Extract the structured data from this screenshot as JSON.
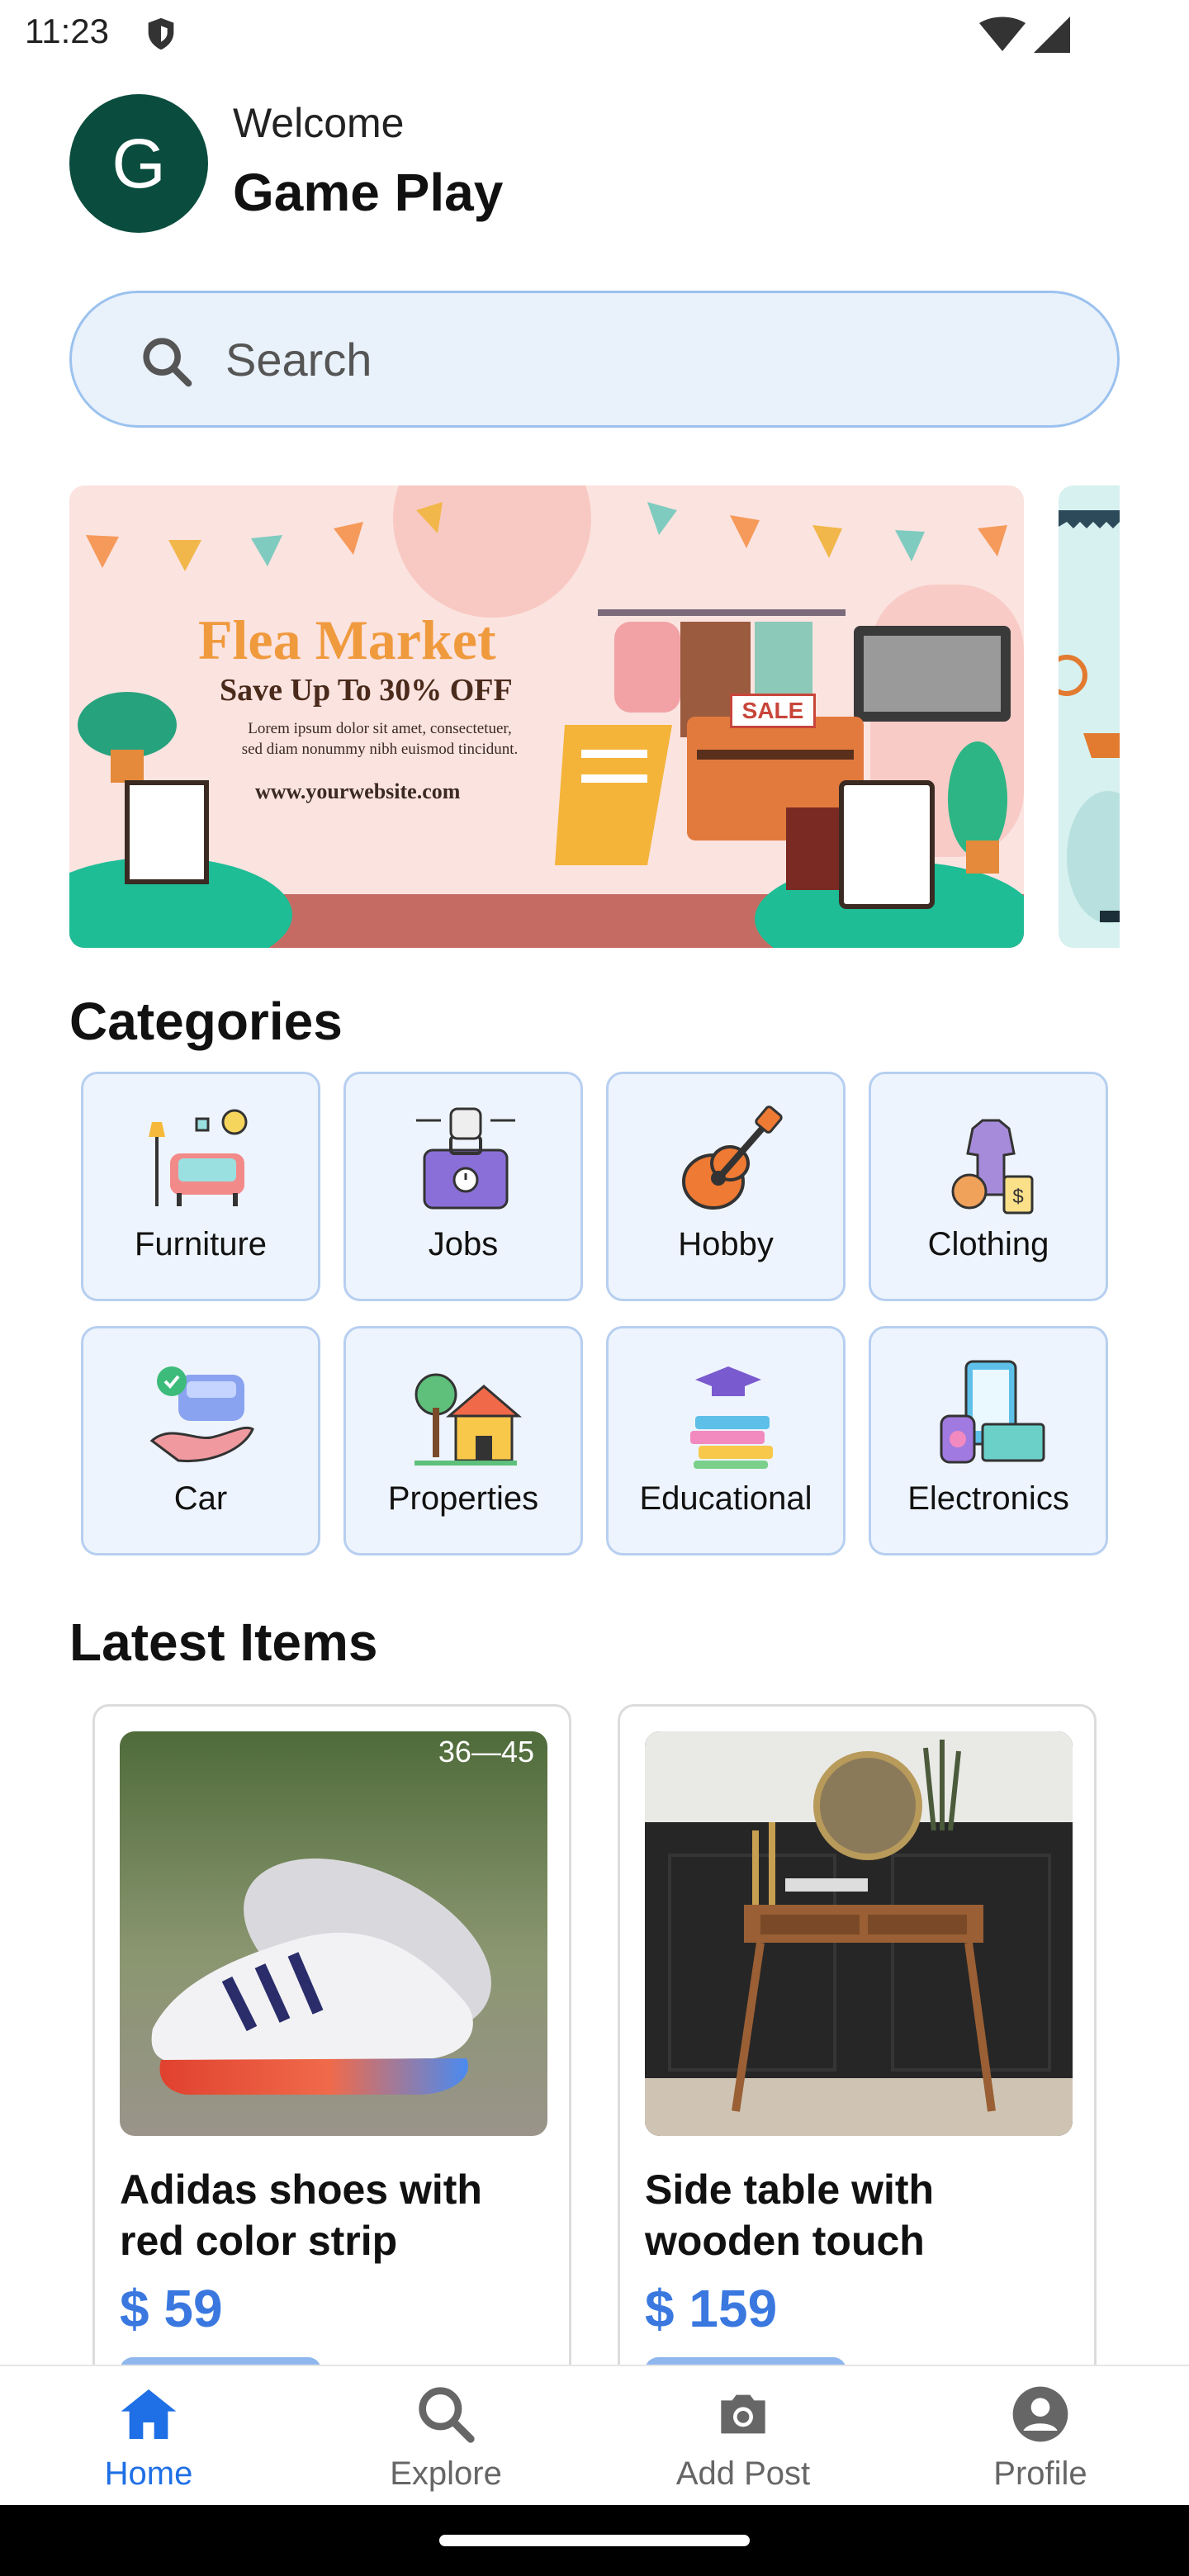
{
  "status_bar": {
    "time": "11:23"
  },
  "header": {
    "avatar_letter": "G",
    "welcome": "Welcome",
    "username": "Game Play"
  },
  "search": {
    "placeholder": "Search"
  },
  "banner": {
    "title": "Flea Market",
    "subtitle": "Save Up To 30% OFF",
    "lorem_line1": "Lorem ipsum dolor sit amet, consectetuer,",
    "lorem_line2": "sed diam nonummy nibh euismod tincidunt.",
    "url": "www.yourwebsite.com",
    "sale": "SALE"
  },
  "categories": {
    "title": "Categories",
    "items": [
      {
        "label": "Furniture",
        "icon": "furniture-icon"
      },
      {
        "label": "Jobs",
        "icon": "jobs-icon"
      },
      {
        "label": "Hobby",
        "icon": "guitar-icon"
      },
      {
        "label": "Clothing",
        "icon": "clothing-icon"
      },
      {
        "label": "Car",
        "icon": "car-icon"
      },
      {
        "label": "Properties",
        "icon": "house-icon"
      },
      {
        "label": "Educational",
        "icon": "books-icon"
      },
      {
        "label": "Electronics",
        "icon": "electronics-icon"
      }
    ]
  },
  "latest": {
    "title": "Latest Items",
    "items": [
      {
        "title": "Adidas shoes with red color strip",
        "price": "$ 59",
        "image_label": "36—45"
      },
      {
        "title": "Side table with wooden touch",
        "price": "$ 159"
      }
    ]
  },
  "nav": {
    "items": [
      {
        "label": "Home",
        "icon": "home-icon",
        "active": true
      },
      {
        "label": "Explore",
        "icon": "search-icon",
        "active": false
      },
      {
        "label": "Add Post",
        "icon": "camera-icon",
        "active": false
      },
      {
        "label": "Profile",
        "icon": "person-icon",
        "active": false
      }
    ]
  },
  "colors": {
    "accent": "#1f6fe6",
    "price": "#3a78e0",
    "avatar": "#0a4d3e"
  }
}
